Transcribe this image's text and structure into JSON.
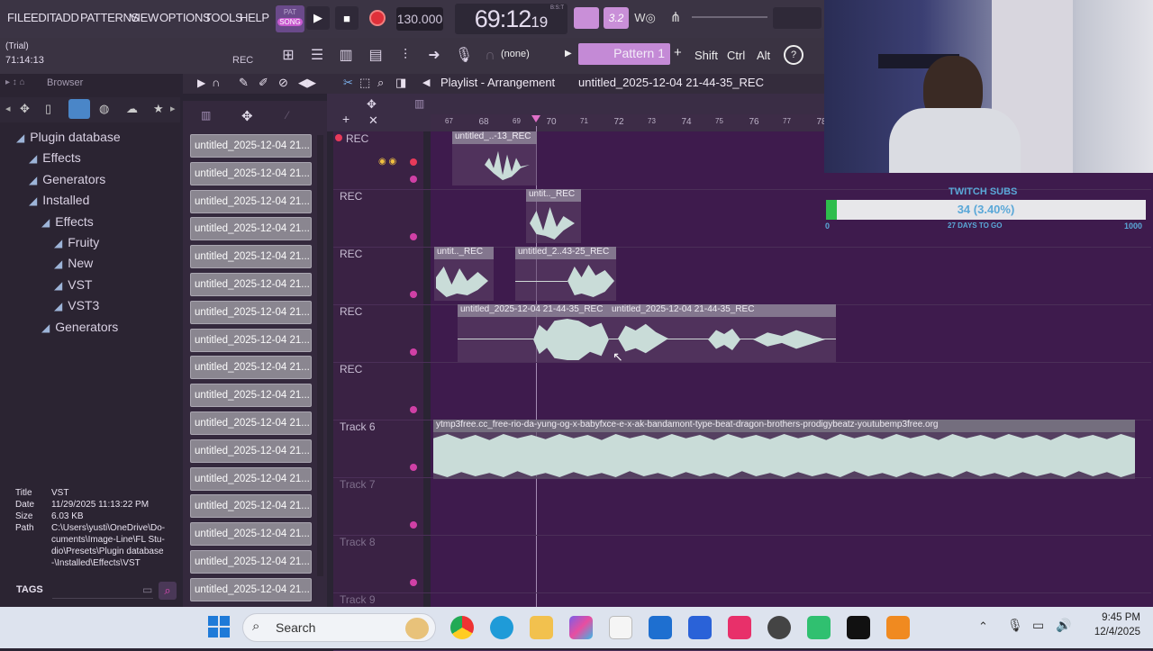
{
  "menu": [
    "FILE",
    "EDIT",
    "ADD",
    "PATTERNS",
    "VIEW",
    "OPTIONS",
    "TOOLS",
    "HELP"
  ],
  "trial": {
    "label": "(Trial)",
    "time": "71:14:13",
    "rec": "REC"
  },
  "transport": {
    "pat": "PAT",
    "song": "SONG",
    "tempo": "130.000",
    "time_main": "69:12",
    "time_sub": "19",
    "time_unit": "B:S:T"
  },
  "row2": {
    "none_label": "(none)",
    "pattern_label": "Pattern 1",
    "plus": "+",
    "shift": "Shift",
    "ctrl": "Ctrl",
    "alt": "Alt"
  },
  "browser": {
    "title": "Browser",
    "items": [
      {
        "label": "Plugin database",
        "indent": 0
      },
      {
        "label": "Effects",
        "indent": 1
      },
      {
        "label": "Generators",
        "indent": 1
      },
      {
        "label": "Installed",
        "indent": 1
      },
      {
        "label": "Effects",
        "indent": 2
      },
      {
        "label": "Fruity",
        "indent": 3
      },
      {
        "label": "New",
        "indent": 3
      },
      {
        "label": "VST",
        "indent": 3
      },
      {
        "label": "VST3",
        "indent": 3
      },
      {
        "label": "Generators",
        "indent": 2
      }
    ],
    "meta": {
      "title_k": "Title",
      "title_v": "VST",
      "date_k": "Date",
      "date_v": "11/29/2025 11:13:22 PM",
      "size_k": "Size",
      "size_v": "6.03 KB",
      "path_k": "Path",
      "path_v1": "C:\\Users\\yusti\\OneDrive\\Do-",
      "path_v2": "cuments\\Image-Line\\FL Stu-",
      "path_v3": "dio\\Presets\\Plugin database",
      "path_v4": "-\\Installed\\Effects\\VST"
    },
    "tags": "TAGS"
  },
  "channels": {
    "items": [
      "untitled_2025-12-04 21...",
      "untitled_2025-12-04 21...",
      "untitled_2025-12-04 21...",
      "untitled_2025-12-04 21...",
      "untitled_2025-12-04 21...",
      "untitled_2025-12-04 21...",
      "untitled_2025-12-04 21...",
      "untitled_2025-12-04 21...",
      "untitled_2025-12-04 21...",
      "untitled_2025-12-04 21...",
      "untitled_2025-12-04 21...",
      "untitled_2025-12-04 21...",
      "untitled_2025-12-04 21...",
      "untitled_2025-12-04 21...",
      "untitled_2025-12-04 21...",
      "untitled_2025-12-04 21...",
      "untitled_2025-12-04 21..."
    ]
  },
  "playlist": {
    "title": "Playlist - Arrangement",
    "file": "untitled_2025-12-04 21-44-35_REC",
    "ruler": [
      "67",
      "68",
      "69",
      "70",
      "71",
      "72",
      "73",
      "74",
      "75",
      "76",
      "77",
      "78"
    ],
    "tracks": [
      "REC",
      "REC",
      "REC",
      "REC",
      "REC",
      "Track 6",
      "Track 7",
      "Track 8",
      "Track 9"
    ],
    "clips": {
      "c1": "untitled_..-13_REC",
      "c2": "untit.._REC",
      "c3": "untit.._REC",
      "c4": "untitled_2..43-25_REC",
      "c5": "untitled_2025-12-04 21-44-35_REC",
      "c6": "untitled_2025-12-04 21-44-35_REC",
      "c7": "ytmp3free.cc_free-rio-da-yung-og-x-babyfxce-e-x-ak-bandamont-type-beat-dragon-brothers-prodigybeatz-youtubemp3free.org"
    }
  },
  "subs": {
    "title": "TWITCH SUBS",
    "value": "34 (3.40%)",
    "progress": 0.034,
    "min": "0",
    "days": "27 DAYS TO GO",
    "max": "1000"
  },
  "taskbar": {
    "search": "Search",
    "time": "9:45 PM",
    "date": "12/4/2025"
  },
  "colors": {
    "accent": "#d040a6",
    "wave": "#c9dcd8",
    "arrange_bg": "#3e1b4d",
    "subs_fill": "#2ebd4c"
  }
}
